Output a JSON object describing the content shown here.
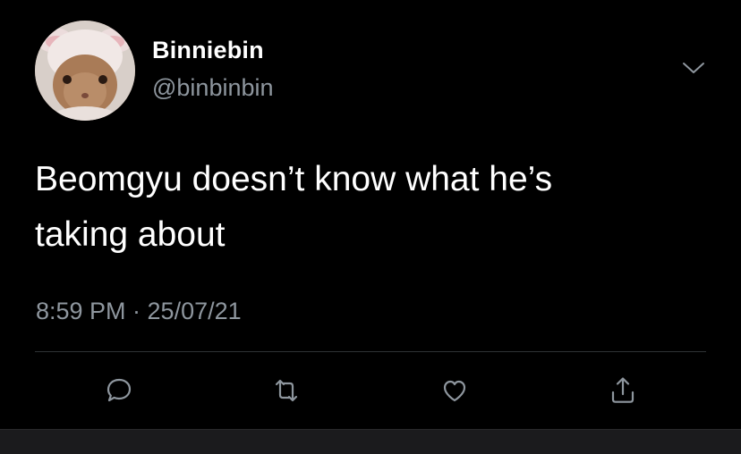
{
  "tweet": {
    "author": {
      "display_name": "Binniebin",
      "handle": "@binbinbin",
      "avatar_icon": "bunny-avatar"
    },
    "text": "Beomgyu doesn’t know what he’s\ntaking about",
    "timestamp": "8:59 PM · 25/07/21",
    "menu_icon": "chevron-down-icon",
    "actions": [
      {
        "name": "reply",
        "icon": "reply-icon"
      },
      {
        "name": "retweet",
        "icon": "retweet-icon"
      },
      {
        "name": "like",
        "icon": "heart-icon"
      },
      {
        "name": "share",
        "icon": "share-icon"
      }
    ]
  },
  "colors": {
    "background": "#000000",
    "text_primary": "#ffffff",
    "text_secondary": "#8e969e",
    "divider": "#2f3336",
    "icon": "#8e969e"
  }
}
